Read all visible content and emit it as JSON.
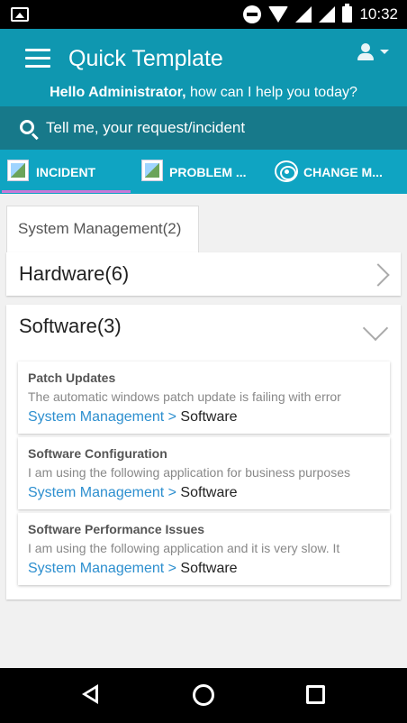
{
  "status_bar": {
    "time": "10:32"
  },
  "header": {
    "title": "Quick Template",
    "greeting_name": "Hello Administrator,",
    "greeting_rest": " how can I help you today?"
  },
  "search": {
    "placeholder": "Tell me, your request/incident"
  },
  "tabs": [
    {
      "label": "INCIDENT",
      "icon": "image-icon",
      "active": true
    },
    {
      "label": "PROBLEM ...",
      "icon": "image-icon"
    },
    {
      "label": "CHANGE M...",
      "icon": "change-icon"
    }
  ],
  "category_tab": {
    "label": "System Management(2)"
  },
  "sections": [
    {
      "title": "Hardware(6)",
      "expanded": false
    },
    {
      "title": "Software(3)",
      "expanded": true
    }
  ],
  "items": [
    {
      "title": "Patch Updates",
      "description": "The automatic windows patch update is failing with error",
      "path_link": "System Management > ",
      "path_current": "Software"
    },
    {
      "title": "Software Configuration",
      "description": "I am using the following application for business purposes",
      "path_link": "System Management > ",
      "path_current": "Software"
    },
    {
      "title": "Software Performance Issues",
      "description": "I am using the following application and it is very slow. It",
      "path_link": "System Management > ",
      "path_current": "Software"
    }
  ],
  "colors": {
    "header": "#0f97b0",
    "search_bar": "#17798a",
    "tabs": "#0fa4c2",
    "tab_indicator": "#c87ad8",
    "link": "#2d8fcf"
  }
}
